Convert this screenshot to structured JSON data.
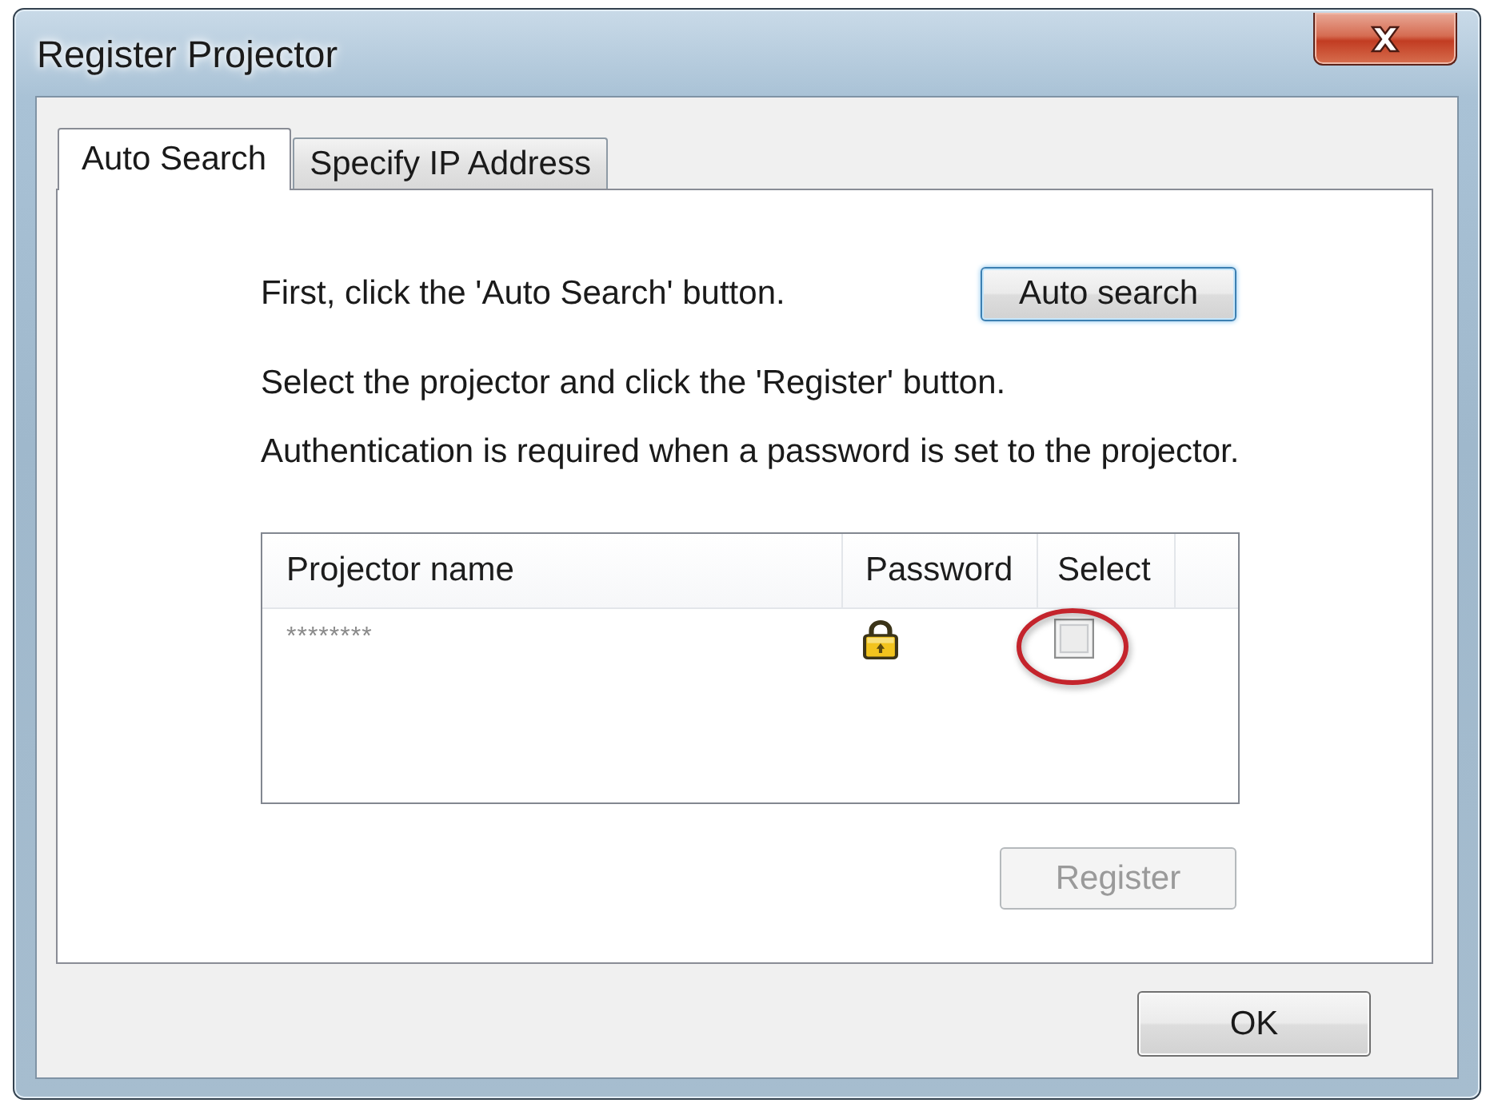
{
  "window": {
    "title": "Register Projector"
  },
  "tabs": [
    {
      "label": "Auto Search",
      "selected": true
    },
    {
      "label": "Specify IP Address",
      "selected": false
    }
  ],
  "auto_search": {
    "text": "First, click the 'Auto Search' button.",
    "button": "Auto search",
    "focused": true
  },
  "instructions": [
    "Select the projector and click the 'Register' button.",
    "Authentication is required when a password is set to the projector."
  ],
  "projector_list": {
    "columns": [
      "Projector name",
      "Password",
      "Select"
    ],
    "rows": [
      {
        "name": "********",
        "password_protected": true,
        "checked": false,
        "circled": true
      }
    ]
  },
  "register_button": {
    "label": "Register",
    "disabled": true
  },
  "ok_button": {
    "label": "OK"
  }
}
